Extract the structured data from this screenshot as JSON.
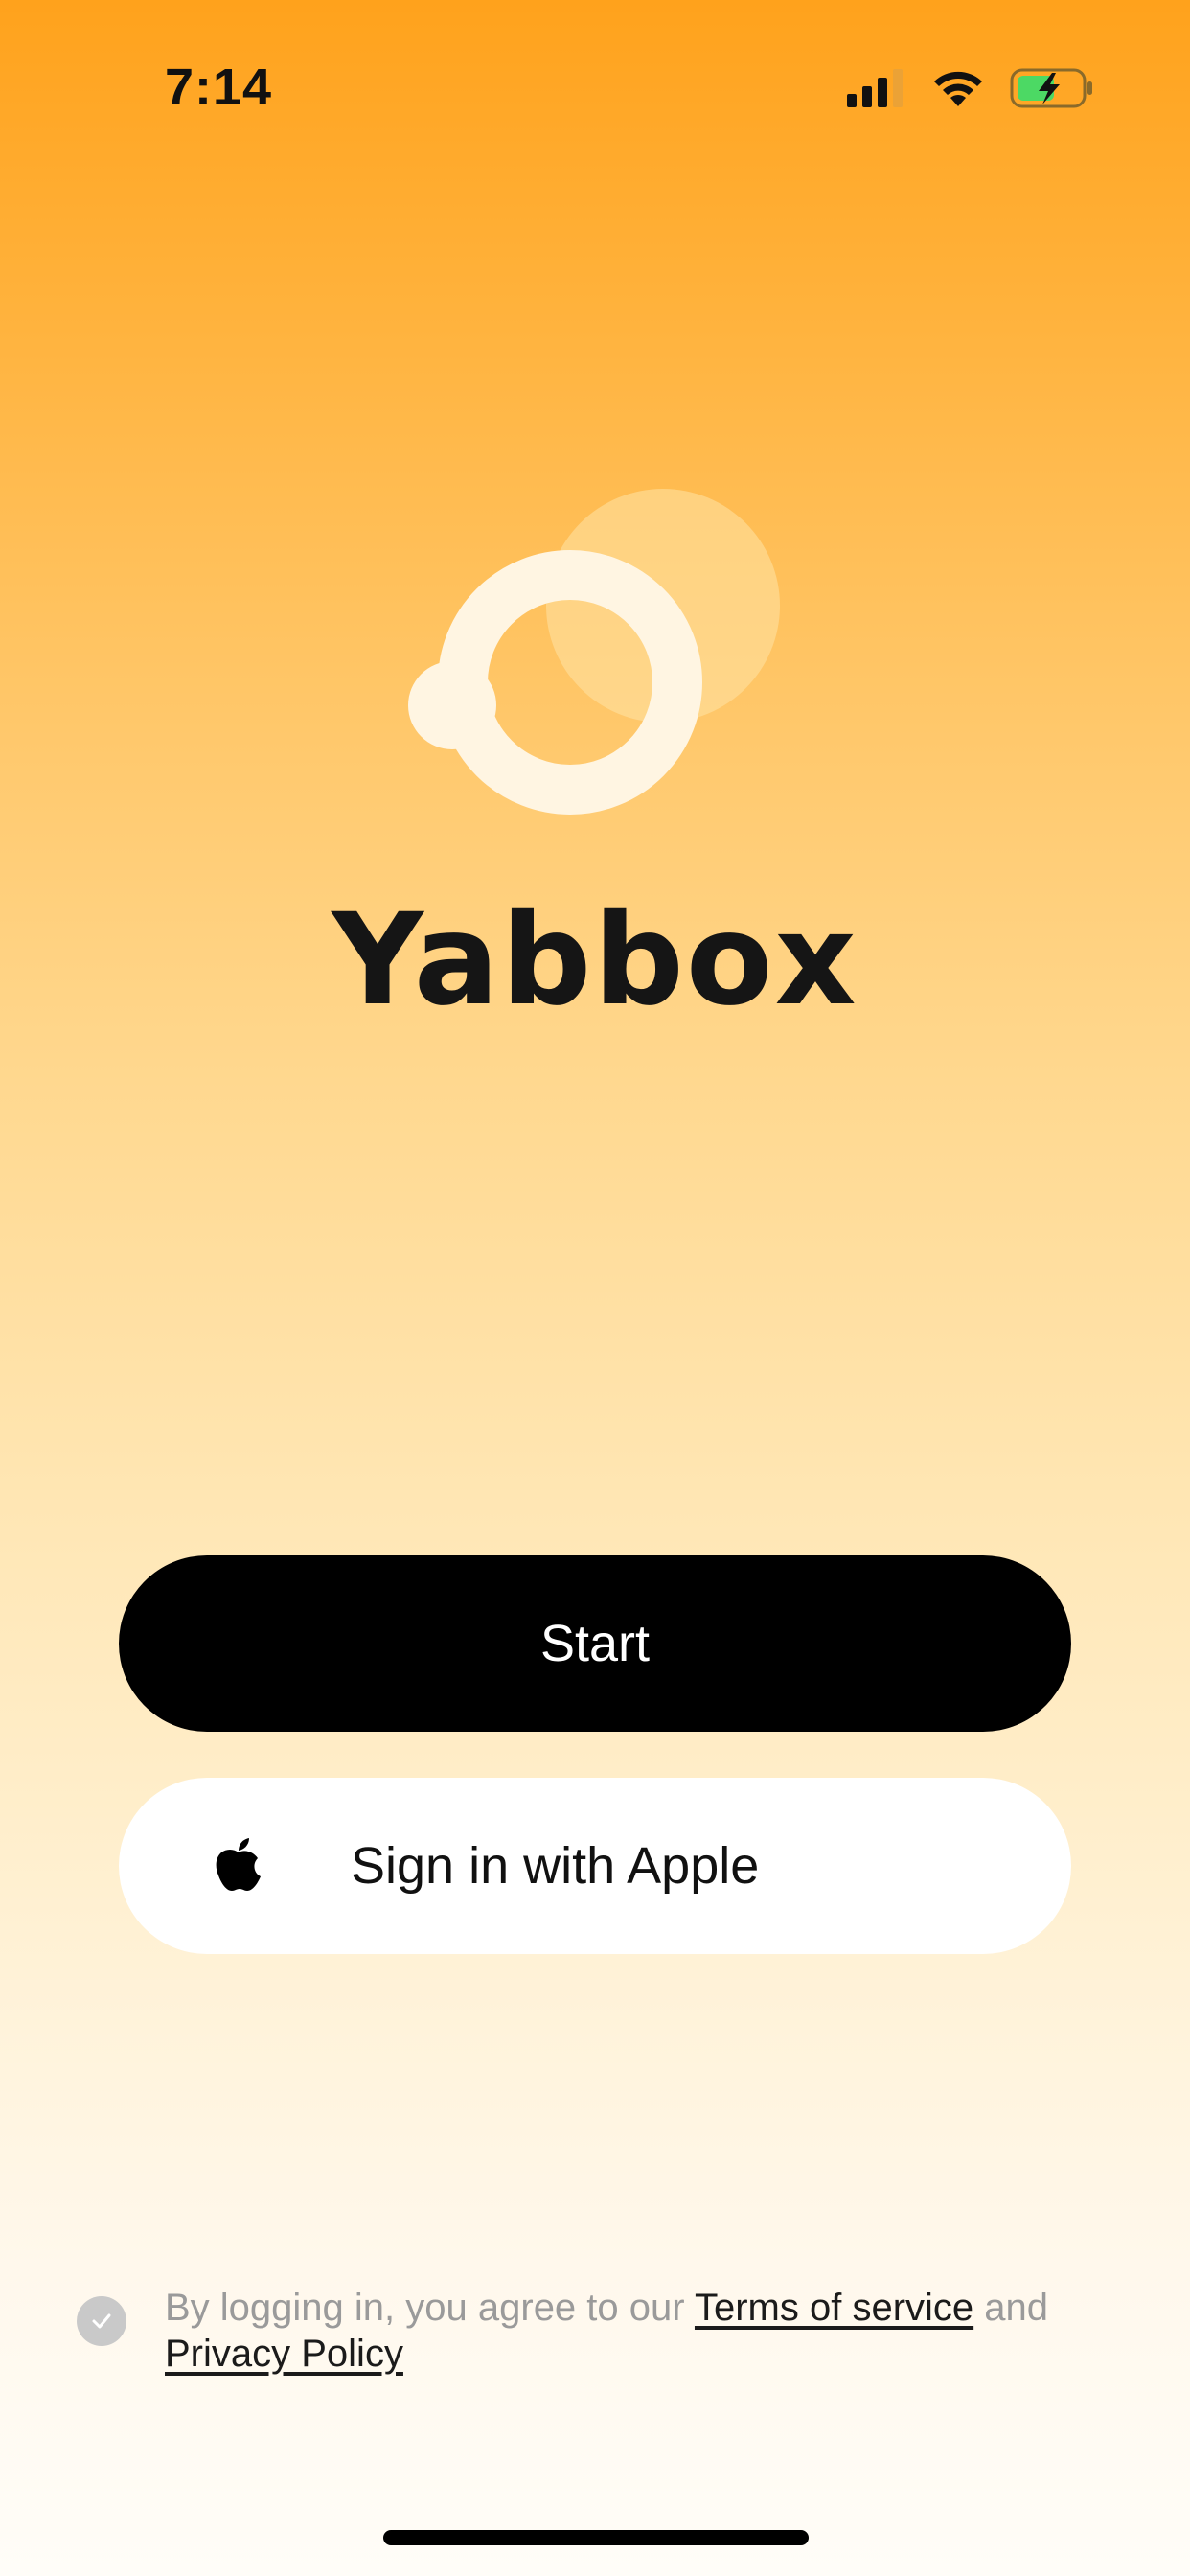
{
  "status_bar": {
    "time": "7:14",
    "icons": [
      "signal-icon",
      "wifi-icon",
      "battery-charging-icon"
    ]
  },
  "brand": {
    "name": "Yabbox",
    "logo": "yabbox-logo-icon"
  },
  "actions": {
    "start_label": "Start",
    "apple_label": "Sign in with Apple",
    "apple_icon": "apple-icon"
  },
  "agreement": {
    "prefix": "By logging in, you agree to our ",
    "terms_label": "Terms of service",
    "conjunction": " and",
    "privacy_label": "Privacy Policy",
    "checkbox_icon": "check-icon"
  },
  "colors": {
    "gradient_top": "#FFA21C",
    "gradient_bottom": "#FFFDF8",
    "primary_button": "#000000",
    "secondary_button": "#FFFFFF",
    "battery_fill": "#4CD964"
  }
}
